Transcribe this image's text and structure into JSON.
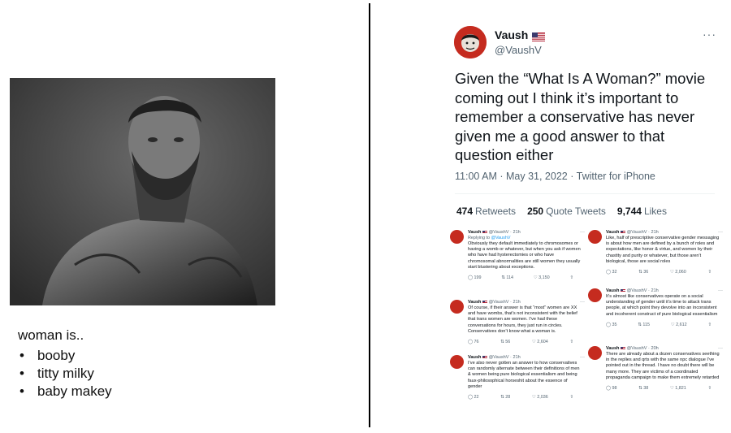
{
  "meme": {
    "intro": "woman is..",
    "items": [
      "booby",
      "titty milky",
      "baby makey"
    ]
  },
  "tweet": {
    "name": "Vaush",
    "flag": "us-flag-icon",
    "handle": "@VaushV",
    "more": "···",
    "text": "Given the “What Is A Woman?” movie coming out I think it’s important to remember a conservative has never given me a good answer to that question either",
    "meta": "11:00 AM · May 31, 2022 · Twitter for iPhone",
    "retweets": "474",
    "retweets_label": "Retweets",
    "quotes": "250",
    "quotes_label": "Quote Tweets",
    "likes": "9,744",
    "likes_label": "Likes"
  },
  "replies": [
    {
      "name": "Vaush",
      "handle": "@VaushV",
      "time": "21h",
      "replying": "Replying to",
      "replying_to": "@VaushV",
      "text": "Obviously they default immediately to chromosomes or having a womb or whatever, but when you ask if women who have had hysterectomies or who have chromosomal abnormalities are still women they usually start blustering about exceptions.",
      "replies": "199",
      "retweets": "114",
      "likes": "3,150"
    },
    {
      "name": "Vaush",
      "handle": "@VaushV",
      "time": "21h",
      "text": "Of course, if their answer is that “most” women are XX and have wombs, that’s not inconsistent with the belief that trans women are women. I’ve had these conversations for hours, they just run in circles. Conservatives don’t know what a woman is.",
      "replies": "76",
      "retweets": "56",
      "likes": "2,604"
    },
    {
      "name": "Vaush",
      "handle": "@VaushV",
      "time": "21h",
      "text": "I’ve also never gotten an answer to how conservatives can randomly alternate between their definitions of men & women being pure biological essentialism and being faux-philosophical horseshit about the essence of gender",
      "replies": "22",
      "retweets": "28",
      "likes": "2,036"
    },
    {
      "name": "Vaush",
      "handle": "@VaushV",
      "time": "21h",
      "text": "Like, half of prescriptive conservative gender messaging is about how men are defined by a bunch of roles and expectations, like honor & virtue, and women by their chastity and purity or whatever, but those aren’t biological, those are social roles",
      "replies": "32",
      "retweets": "36",
      "likes": "2,060"
    },
    {
      "name": "Vaush",
      "handle": "@VaushV",
      "time": "21h",
      "text": "It’s almost like conservatives operate on a social understanding of gender until it’s time to attack trans people, at which point they devolve into an inconsistent and incoherent construct of pure biological essentialism",
      "replies": "35",
      "retweets": "115",
      "likes": "2,612"
    },
    {
      "name": "Vaush",
      "handle": "@VaushV",
      "time": "20h",
      "text": "There are already about a dozen conservatives seething in the replies and qrts with the same npc dialogue I’ve pointed out in the thread. I have no doubt there will be many more. They are victims of a coordinated propaganda campaign to make them extremely retarded",
      "replies": "98",
      "retweets": "38",
      "likes": "1,821"
    }
  ],
  "colors": {
    "avatar_red": "#c52b1f",
    "secondary_text": "#536471",
    "link_blue": "#1d9bf0"
  }
}
